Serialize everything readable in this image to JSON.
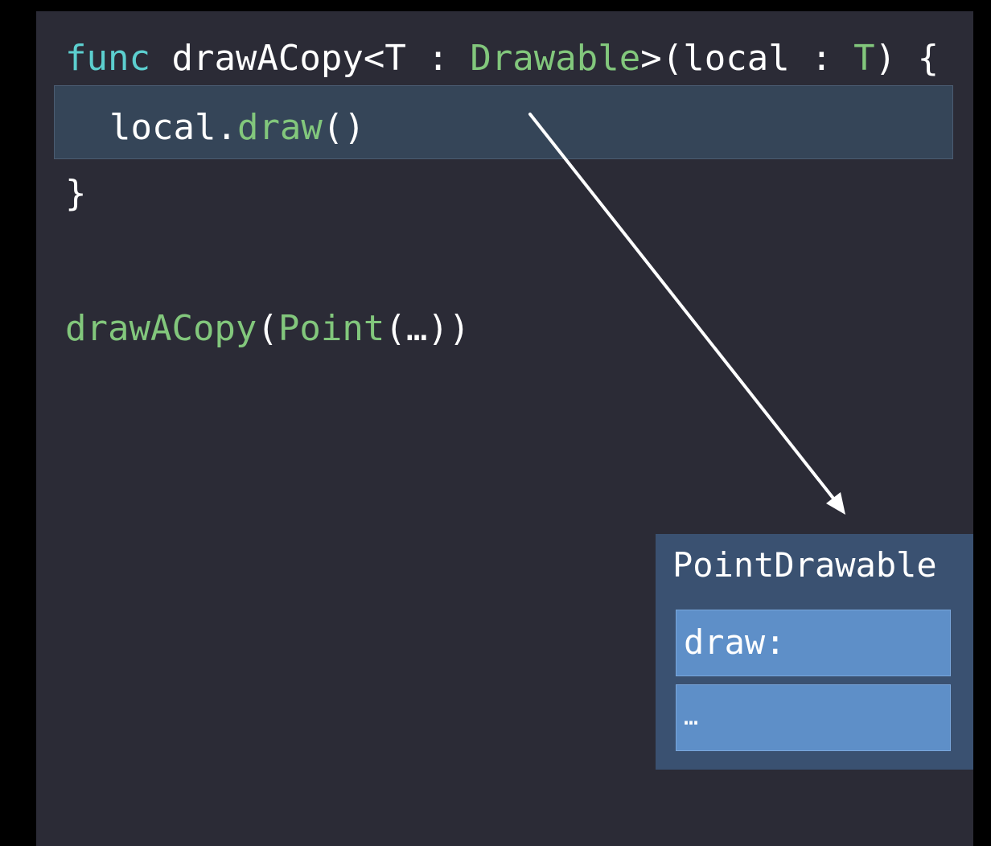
{
  "code": {
    "line1": {
      "kw": "func",
      "name": " drawACopy<T : ",
      "protocol": "Drawable",
      "params_open": ">(local : ",
      "param_type": "T",
      "params_close": ") {"
    },
    "line2": {
      "receiver": "local.",
      "method": "draw",
      "parens": "()"
    },
    "line3": {
      "brace": "}"
    },
    "line4": {
      "fn": "drawACopy",
      "open": "(",
      "ctor": "Point",
      "args": "(…))"
    }
  },
  "vtable": {
    "title": "PointDrawable",
    "rows": [
      "draw:",
      "…"
    ]
  },
  "colors": {
    "background": "#2b2b36",
    "keyword": "#5ccfcf",
    "type": "#82c77c",
    "highlight": "#354558",
    "table": "#3a5171",
    "table_row": "#5e8fc8"
  }
}
